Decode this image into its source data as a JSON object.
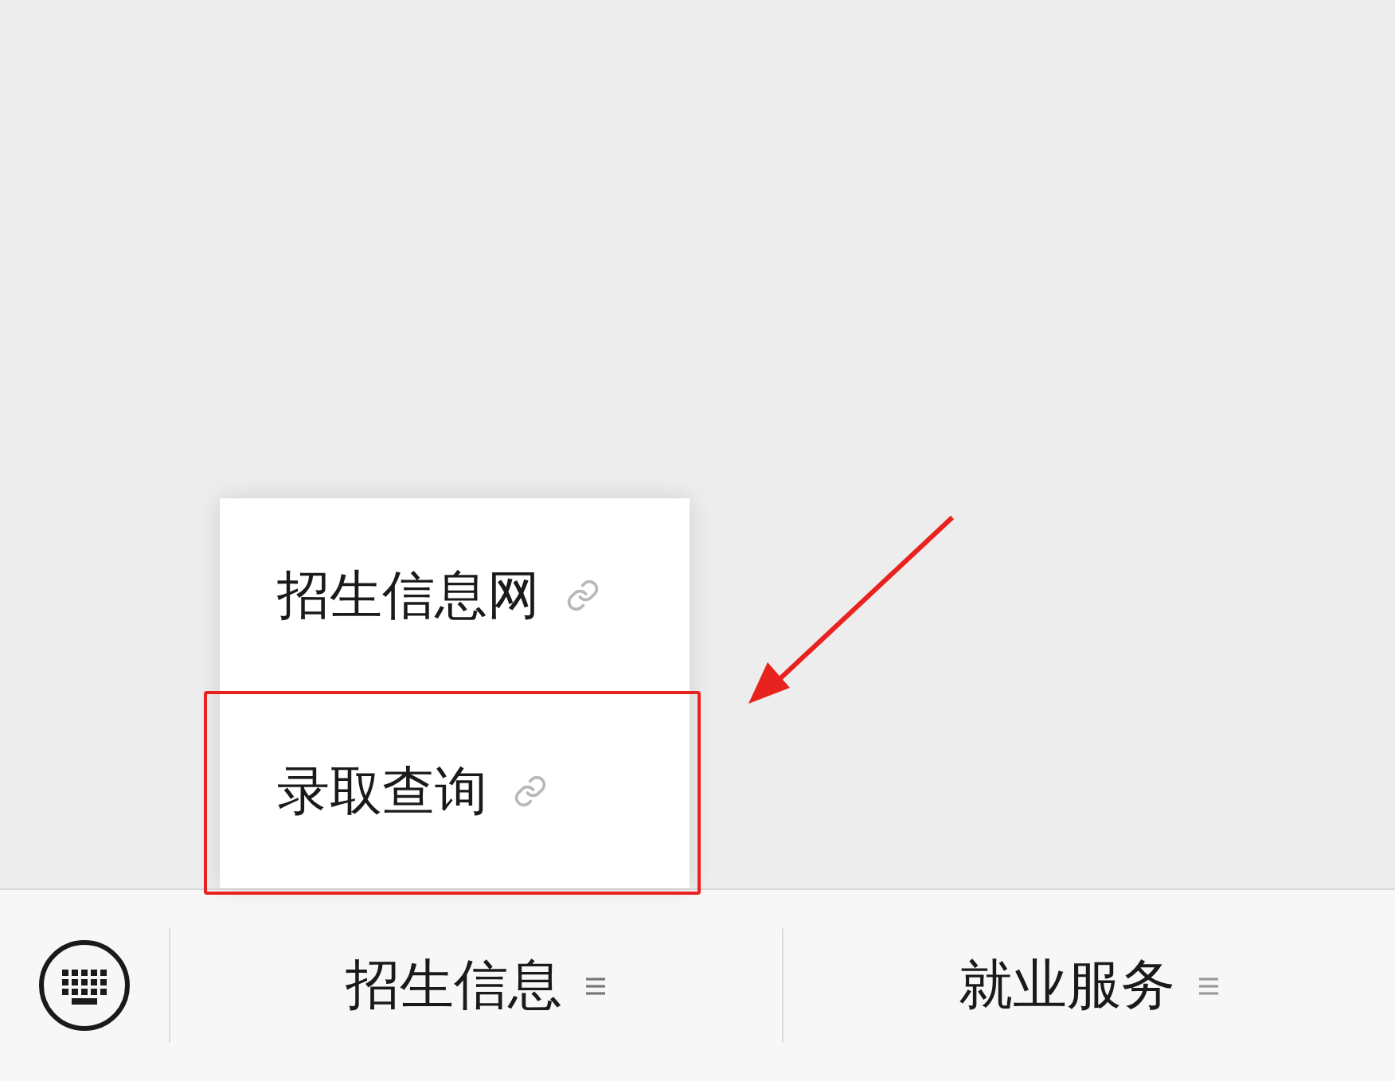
{
  "popup_menu": {
    "items": [
      {
        "label": "招生信息网",
        "highlighted": false
      },
      {
        "label": "录取查询",
        "highlighted": true
      }
    ]
  },
  "menu_bar": {
    "items": [
      {
        "label": "招生信息",
        "expanded": true
      },
      {
        "label": "就业服务",
        "expanded": false
      }
    ]
  }
}
